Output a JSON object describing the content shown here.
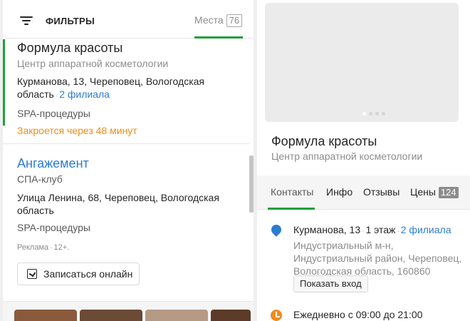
{
  "colors": {
    "accent": "#21a038",
    "link": "#2b7dd3",
    "warning": "#f08c1a"
  },
  "header": {
    "filter_label": "ФИЛЬТРЫ",
    "places_label": "Места",
    "places_count": "76"
  },
  "results": [
    {
      "title": "Формула красоты",
      "category": "Центр аппаратной косметологии",
      "address": "Курманова, 13, Череповец, Вологодская область",
      "branches": "2 филиала",
      "tag": "SPA-процедуры",
      "status": "Закроется через 48 минут"
    },
    {
      "title": "Ангажемент",
      "category": "СПА-клуб",
      "address": "Улица Ленина, 68, Череповец, Вологодская область",
      "tag": "SPA-процедуры",
      "ad_label": "Реклама",
      "age_label": "12+.",
      "book_button": "Записаться онлайн"
    }
  ],
  "detail": {
    "title": "Формула красоты",
    "category": "Центр аппаратной косметологии",
    "tabs": [
      {
        "label": "Контакты"
      },
      {
        "label": "Инфо"
      },
      {
        "label": "Отзывы"
      },
      {
        "label": "Цены",
        "count": "124"
      }
    ],
    "address_street": "Курманова, 13",
    "address_floor": "1 этаж",
    "address_branches": "2 филиала",
    "address_details": "Индустриальный м-н, Индустриальный район, Череповец, Вологодская область, 160860",
    "show_entrance": "Показать вход",
    "hours": "Ежедневно с 09:00 до 21:00"
  }
}
